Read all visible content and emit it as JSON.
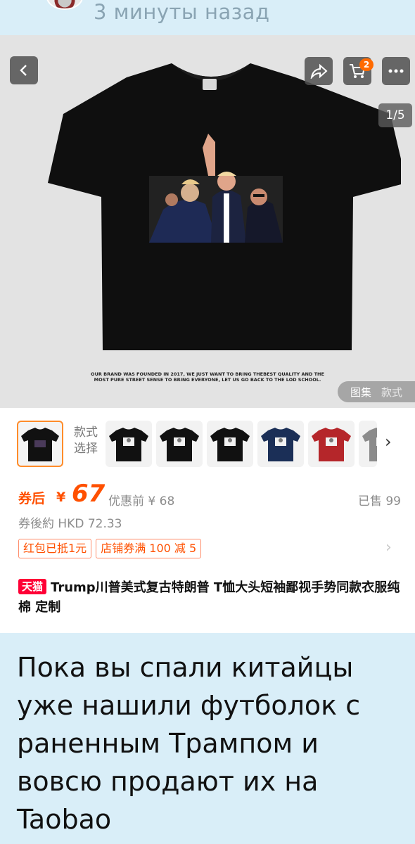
{
  "post_header": {
    "timestamp": "3 минуты назад"
  },
  "product": {
    "image_counter": "1/5",
    "cart_badge": "2",
    "gallery_tabs": [
      "图集",
      "款式"
    ],
    "tag_text": "OUR BRAND WAS FOUNDED IN 2017, WE JUST WANT TO BRING THEBEST QUALITY AND THE MOST PURE STREET SENSE TO BRING EVERYONE, LET US GO BACK TO THE LOD SCHOOL.",
    "variant_label_line1": "款式",
    "variant_label_line2": "选择",
    "variant_colors": [
      "#111111",
      "#111111",
      "#111111",
      "#1b2f57",
      "#b5262a",
      "#8b8b8b"
    ],
    "coupon_label": "券后",
    "currency": "¥",
    "price": "67",
    "original_price": "优惠前 ¥ 68",
    "sold": "已售 99",
    "hkd_price": "券後約 HKD 72.33",
    "promos": [
      "红包已抵1元",
      "店铺券满 100 减 5"
    ],
    "store_badge": "天猫",
    "title": "Trump川普美式复古特朗普 T恤大头短袖鄙视手势同款衣服纯棉 定制"
  },
  "caption": "Пока вы спали китайцы уже нашили футболок с раненным Трампом и вовсю продают их на Taobao",
  "colors": {
    "accent": "#ff5000",
    "background": "#d9eef8",
    "tmall_red": "#ff0036"
  }
}
